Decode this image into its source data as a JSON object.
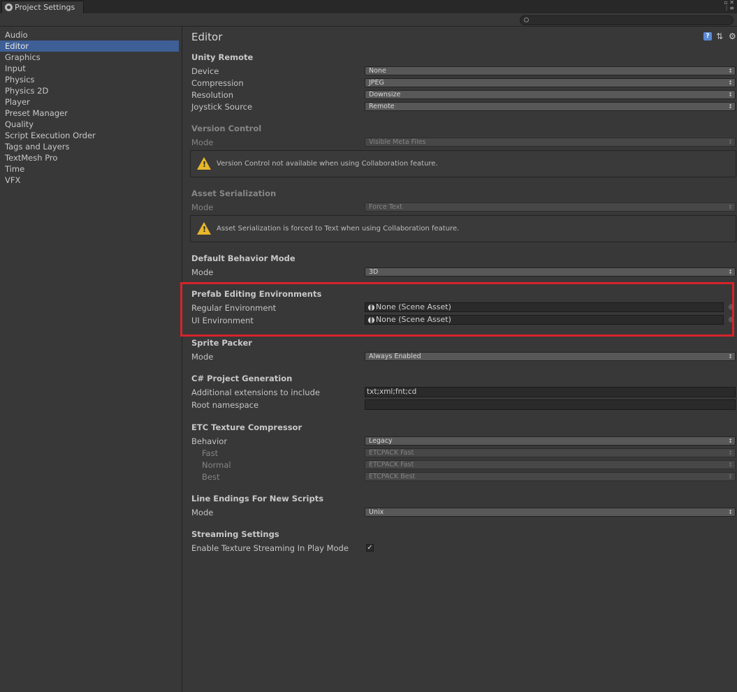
{
  "window": {
    "tab_title": "Project Settings",
    "controls": "▫ ✕\n⋮≡"
  },
  "search": {
    "placeholder": "",
    "value": ""
  },
  "sidebar": {
    "items": [
      {
        "label": "Audio"
      },
      {
        "label": "Editor",
        "selected": true
      },
      {
        "label": "Graphics"
      },
      {
        "label": "Input"
      },
      {
        "label": "Physics"
      },
      {
        "label": "Physics 2D"
      },
      {
        "label": "Player"
      },
      {
        "label": "Preset Manager"
      },
      {
        "label": "Quality"
      },
      {
        "label": "Script Execution Order"
      },
      {
        "label": "Tags and Layers"
      },
      {
        "label": "TextMesh Pro"
      },
      {
        "label": "Time"
      },
      {
        "label": "VFX"
      }
    ]
  },
  "main": {
    "title": "Editor",
    "header_icons": {
      "help": "?",
      "preset": "⇅",
      "settings": "⚙"
    },
    "unity_remote": {
      "heading": "Unity Remote",
      "device_label": "Device",
      "device_value": "None",
      "compression_label": "Compression",
      "compression_value": "JPEG",
      "resolution_label": "Resolution",
      "resolution_value": "Downsize",
      "joystick_label": "Joystick Source",
      "joystick_value": "Remote"
    },
    "version_control": {
      "heading": "Version Control",
      "mode_label": "Mode",
      "mode_value": "Visible Meta Files",
      "warning": "Version Control not available when using Collaboration feature."
    },
    "asset_serialization": {
      "heading": "Asset Serialization",
      "mode_label": "Mode",
      "mode_value": "Force Text",
      "warning": "Asset Serialization is forced to Text when using Collaboration feature."
    },
    "default_behavior": {
      "heading": "Default Behavior Mode",
      "mode_label": "Mode",
      "mode_value": "3D"
    },
    "prefab_editing": {
      "heading": "Prefab Editing Environments",
      "regular_label": "Regular Environment",
      "regular_value": "None (Scene Asset)",
      "ui_label": "UI Environment",
      "ui_value": "None (Scene Asset)"
    },
    "sprite_packer": {
      "heading": "Sprite Packer",
      "mode_label": "Mode",
      "mode_value": "Always Enabled"
    },
    "csharp_project": {
      "heading": "C# Project Generation",
      "extensions_label": "Additional extensions to include",
      "extensions_value": "txt;xml;fnt;cd",
      "namespace_label": "Root namespace",
      "namespace_value": ""
    },
    "etc_compressor": {
      "heading": "ETC Texture Compressor",
      "behavior_label": "Behavior",
      "behavior_value": "Legacy",
      "fast_label": "Fast",
      "fast_value": "ETCPACK Fast",
      "normal_label": "Normal",
      "normal_value": "ETCPACK Fast",
      "best_label": "Best",
      "best_value": "ETCPACK Best"
    },
    "line_endings": {
      "heading": "Line Endings For New Scripts",
      "mode_label": "Mode",
      "mode_value": "Unix"
    },
    "streaming": {
      "heading": "Streaming Settings",
      "texture_label": "Enable Texture Streaming In Play Mode",
      "texture_checked": "✓"
    }
  },
  "colors": {
    "highlight": "#d6232b",
    "selection": "#3e5f96",
    "warning": "#e8b62a"
  }
}
